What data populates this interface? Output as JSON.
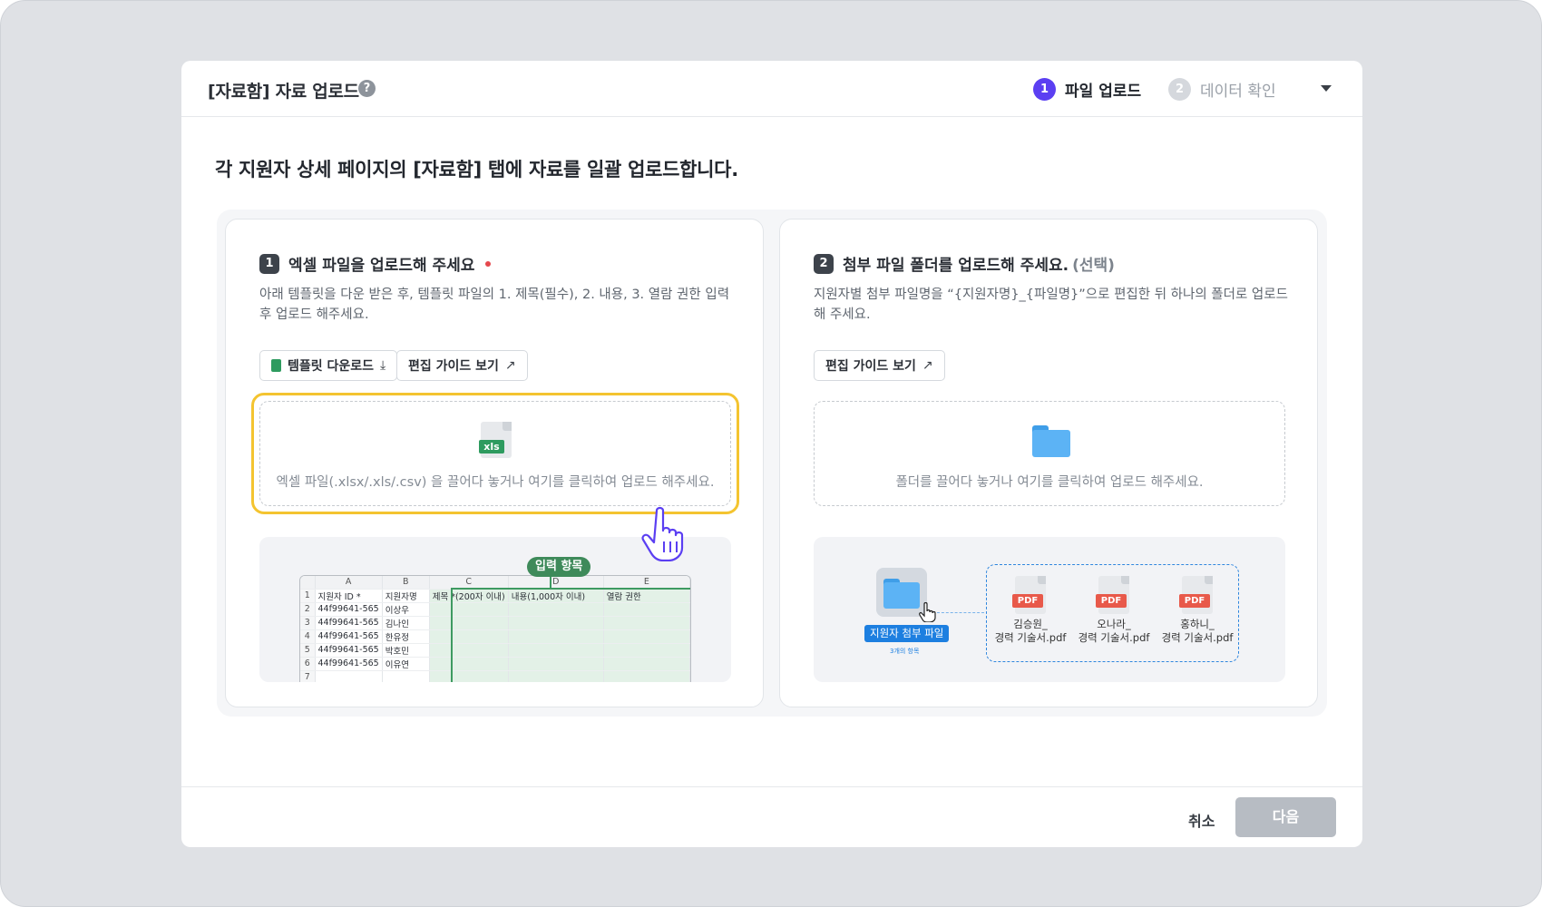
{
  "modal": {
    "title": "[자료함] 자료 업로드",
    "help_icon": "question-icon",
    "steps": [
      {
        "num": "1",
        "label": "파일 업로드",
        "active": true
      },
      {
        "num": "2",
        "label": "데이터 확인",
        "active": false
      }
    ],
    "headline": "각 지원자 상세 페이지의 [자료함] 탭에 자료를 일괄 업로드합니다."
  },
  "left_card": {
    "badge": "1",
    "title": "엑셀 파일을 업로드해 주세요",
    "desc": "아래 템플릿을 다운 받은 후, 템플릿 파일의   1. 제목(필수), 2. 내용, 3. 열람 권한 입력 후 업로드 해주세요.",
    "btn_template": "템플릿 다운로드",
    "btn_guide": "편집 가이드 보기",
    "file_badge": "xls",
    "drop_text": "엑셀 파일(.xlsx/.xls/.csv) 을 끌어다 놓거나 여기를 클릭하여 업로드 해주세요.",
    "pill": "입력 항목",
    "sheet": {
      "cols": [
        "A",
        "B",
        "C",
        "D",
        "E"
      ],
      "header": [
        "지원자 ID *",
        "지원자명",
        "제목 *(200자 이내)",
        "내용(1,000자 이내)",
        "열람 권한"
      ],
      "rows": [
        {
          "n": "1"
        },
        {
          "n": "2",
          "id": "44f99641-565",
          "name": "이상우"
        },
        {
          "n": "3",
          "id": "44f99641-565",
          "name": "김나인"
        },
        {
          "n": "4",
          "id": "44f99641-565",
          "name": "한유정"
        },
        {
          "n": "5",
          "id": "44f99641-565",
          "name": "박호민"
        },
        {
          "n": "6",
          "id": "44f99641-565",
          "name": "이유연"
        },
        {
          "n": "7",
          "id": "",
          "name": ""
        }
      ]
    }
  },
  "right_card": {
    "badge": "2",
    "title": "첨부 파일 폴더를 업로드해 주세요.",
    "optional": "(선택)",
    "desc": "지원자별 첨부 파일명을 “{지원자명}_{파일명}”으로 편집한 뒤 하나의 폴더로 업로드 해 주세요.",
    "btn_guide": "편집 가이드 보기",
    "drop_text": "폴더를 끌어다 놓거나 여기를 클릭하여 업로드 해주세요.",
    "folder_tag": "지원자 첨부 파일",
    "folder_sub": "3개의 항목",
    "pdf_badge": "PDF",
    "pdfs": [
      {
        "line1": "김승원_",
        "line2": "경력 기술서.pdf"
      },
      {
        "line1": "오나라_",
        "line2": "경력 기술서.pdf"
      },
      {
        "line1": "홍하니_",
        "line2": "경력 기술서.pdf"
      }
    ]
  },
  "footer": {
    "cancel": "취소",
    "next": "다음"
  },
  "colors": {
    "accent": "#5b3ff2",
    "highlight": "#f4c430",
    "excel_green": "#2e9b5f",
    "folder_blue": "#5cb3f5",
    "pdf_red": "#e8594a",
    "disabled": "#b7bcc3"
  }
}
